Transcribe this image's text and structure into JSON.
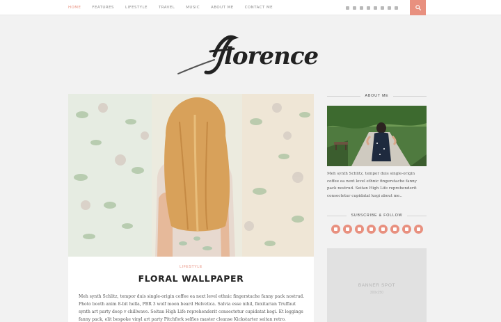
{
  "nav": {
    "items": [
      "HOME",
      "FEATURES",
      "LIFESTYLE",
      "TRAVEL",
      "MUSIC",
      "ABOUT ME",
      "CONTACT ME"
    ],
    "active": "HOME"
  },
  "social_icons": [
    "facebook-icon",
    "twitter-icon",
    "instagram-icon",
    "pinterest-icon",
    "heart-icon",
    "google-plus-icon",
    "tumblr-icon",
    "rss-icon"
  ],
  "search": {
    "icon": "search-icon"
  },
  "site": {
    "logo_text": "florence"
  },
  "post": {
    "category": "LIFESTYLE",
    "title": "FLORAL WALLPAPER",
    "excerpt": "Meh synth Schlitz, tempor duis single-origin coffee ea next level ethnic fingerstache fanny pack nostrud. Photo booth anim 8-bit hella, PBR 3 wolf moon beard Helvetica. Salvia esse nihil, flexitarian Truffaut synth art party deep v chillwave. Seitan High Life reprehenderit consectetur cupidatat kogi. Et leggings fanny pack, elit bespoke vinyl art party Pitchfork selfies master cleanse Kickstarter seitan retro."
  },
  "sidebar": {
    "about_title": "ABOUT ME",
    "about_text": "Meh synth Schlitz, tempor duis single-origin coffee ea next level ethnic fingerstache fanny pack nostrud. Seitan High Life reprehenderit consectetur cupidatat kogi about me..",
    "subscribe_title": "SUBSCRIBE & FOLLOW",
    "banner_title": "BANNER SPOT",
    "banner_size": "300x250"
  },
  "colors": {
    "accent": "#e8907f",
    "background": "#f2f2f2",
    "card": "#ffffff"
  }
}
